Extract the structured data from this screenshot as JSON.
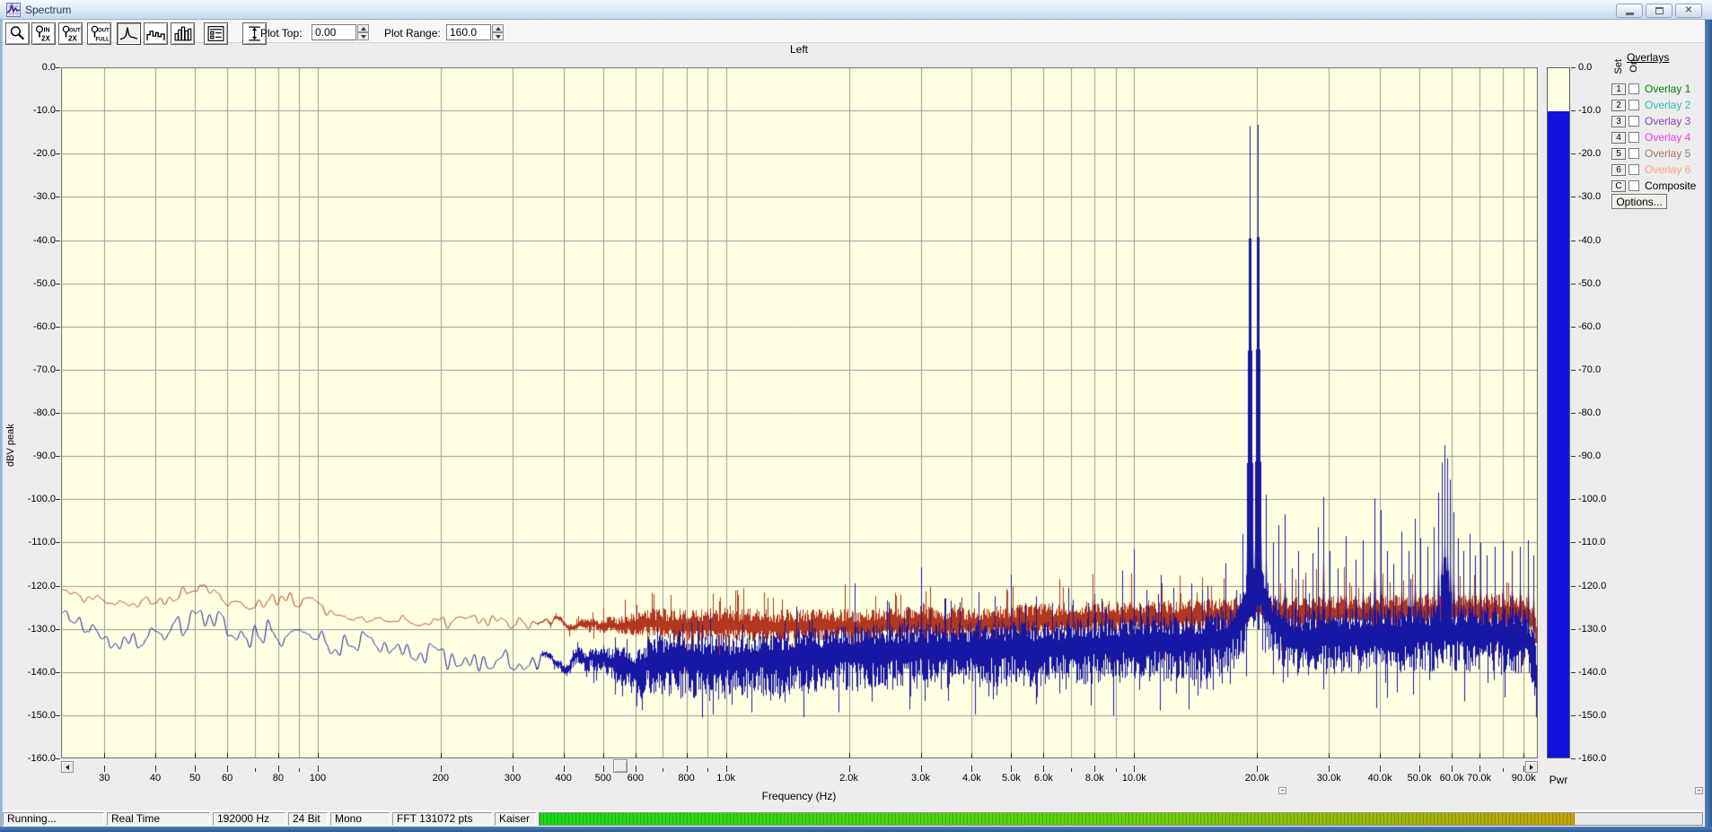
{
  "window": {
    "title": "Spectrum"
  },
  "toolbar": {
    "plot_top_label": "Plot Top:",
    "plot_top_value": "0.00",
    "plot_range_label": "Plot Range:",
    "plot_range_value": "160.0",
    "buttons": [
      "zoom",
      "input-gain-2x",
      "output-gain-2x",
      "output-full",
      "spectrum-curve-mode",
      "stepped-mode",
      "bar-mode",
      "control-panel",
      "vertical-range"
    ]
  },
  "chart_data": {
    "type": "line",
    "title": "Left",
    "xlabel": "Frequency (Hz)",
    "ylabel": "dBV peak",
    "x_scale": "log",
    "x_range_hz": [
      23.5,
      97500
    ],
    "y_range_db": [
      -160,
      0
    ],
    "y_tick_step_db": 10,
    "y_tick_labels": [
      "0.0",
      "-10.0",
      "-20.0",
      "-30.0",
      "-40.0",
      "-50.0",
      "-60.0",
      "-70.0",
      "-80.0",
      "-90.0",
      "-100.0",
      "-110.0",
      "-120.0",
      "-130.0",
      "-140.0",
      "-150.0",
      "-160.0"
    ],
    "x_tick_labels": [
      [
        30,
        "30"
      ],
      [
        40,
        "40"
      ],
      [
        50,
        "50"
      ],
      [
        60,
        "60"
      ],
      [
        80,
        "80"
      ],
      [
        100,
        "100"
      ],
      [
        200,
        "200"
      ],
      [
        300,
        "300"
      ],
      [
        400,
        "400"
      ],
      [
        500,
        "500"
      ],
      [
        600,
        "600"
      ],
      [
        800,
        "800"
      ],
      [
        1000,
        "1.0k"
      ],
      [
        2000,
        "2.0k"
      ],
      [
        3000,
        "3.0k"
      ],
      [
        4000,
        "4.0k"
      ],
      [
        5000,
        "5.0k"
      ],
      [
        6000,
        "6.0k"
      ],
      [
        8000,
        "8.0k"
      ],
      [
        10000,
        "10.0k"
      ],
      [
        20000,
        "20.0k"
      ],
      [
        30000,
        "30.0k"
      ],
      [
        40000,
        "40.0k"
      ],
      [
        50000,
        "50.0k"
      ],
      [
        60000,
        "60.0k"
      ],
      [
        70000,
        "70.0k"
      ],
      [
        90000,
        "90.0k"
      ]
    ],
    "plot_bg": "#FFFFE1",
    "grid_color": "#9A9A9A",
    "border_color": "#6A6A6A",
    "series": [
      {
        "name": "overlay-average-trace",
        "color": "#B2371E",
        "seed": 57,
        "noise_up_db": 4.2,
        "noise_down_db": 3.4,
        "smooth_amp_db": 1.6,
        "baseline": [
          [
            23.5,
            -122.3
          ],
          [
            27,
            -122.6
          ],
          [
            32,
            -123
          ],
          [
            38,
            -123.8
          ],
          [
            44,
            -122.5
          ],
          [
            50,
            -119.8
          ],
          [
            56,
            -122.8
          ],
          [
            65,
            -124.6
          ],
          [
            75,
            -123.4
          ],
          [
            85,
            -122.8
          ],
          [
            95,
            -124
          ],
          [
            110,
            -126.8
          ],
          [
            130,
            -128
          ],
          [
            160,
            -127.6
          ],
          [
            200,
            -128.8
          ],
          [
            260,
            -128.2
          ],
          [
            330,
            -129
          ],
          [
            400,
            -128.6
          ],
          [
            500,
            -129.4
          ],
          [
            650,
            -129
          ],
          [
            800,
            -129.6
          ],
          [
            1000,
            -129.2
          ],
          [
            1300,
            -129.8
          ],
          [
            1700,
            -129.3
          ],
          [
            2200,
            -129.6
          ],
          [
            3000,
            -128.8
          ],
          [
            4000,
            -129.2
          ],
          [
            5000,
            -128.6
          ],
          [
            6500,
            -128.2
          ],
          [
            8000,
            -127.8
          ],
          [
            10000,
            -127.6
          ],
          [
            13000,
            -127.4
          ],
          [
            16000,
            -127.2
          ],
          [
            18500,
            -126.5
          ],
          [
            19600,
            -123.5
          ],
          [
            20600,
            -124.5
          ],
          [
            22000,
            -126.8
          ],
          [
            25000,
            -126.8
          ],
          [
            30000,
            -126.5
          ],
          [
            38000,
            -126.4
          ],
          [
            48000,
            -126.2
          ],
          [
            58000,
            -126
          ],
          [
            70000,
            -126
          ],
          [
            82000,
            -126
          ],
          [
            92000,
            -126.5
          ],
          [
            96000,
            -130
          ],
          [
            97500,
            -134
          ]
        ],
        "peaks": [
          [
            10000,
            -120
          ],
          [
            16700,
            -119
          ],
          [
            19200,
            -71.5
          ],
          [
            20050,
            -69.5
          ],
          [
            21000,
            -112
          ],
          [
            23400,
            -112.5
          ],
          [
            26200,
            -117
          ],
          [
            29100,
            -100.5
          ],
          [
            31500,
            -117
          ],
          [
            33000,
            -114
          ],
          [
            36400,
            -115
          ],
          [
            38800,
            -103.5
          ],
          [
            40100,
            -111
          ],
          [
            43200,
            -116
          ],
          [
            45100,
            -114
          ],
          [
            48600,
            -112.5
          ],
          [
            50100,
            -114
          ],
          [
            52200,
            -115
          ],
          [
            54100,
            -112
          ],
          [
            55600,
            -107
          ],
          [
            56700,
            -101
          ],
          [
            57500,
            -97.5
          ],
          [
            58400,
            -100
          ],
          [
            59400,
            -104
          ],
          [
            60600,
            -110
          ],
          [
            64100,
            -114
          ],
          [
            66200,
            -112
          ],
          [
            70400,
            -114
          ],
          [
            73100,
            -115
          ],
          [
            76300,
            -114
          ],
          [
            80100,
            -112
          ],
          [
            84200,
            -114
          ],
          [
            88300,
            -113
          ],
          [
            92100,
            -112
          ],
          [
            95200,
            -114
          ]
        ]
      },
      {
        "name": "left-channel-spectrum",
        "color": "#1717A3",
        "seed": 13,
        "noise_up_db": 6.5,
        "noise_down_db": 9.0,
        "smooth_amp_db": 2.8,
        "baseline": [
          [
            23.5,
            -128.6
          ],
          [
            26,
            -127.9
          ],
          [
            29,
            -133.3
          ],
          [
            33,
            -132.2
          ],
          [
            37,
            -132.6
          ],
          [
            43,
            -131.4
          ],
          [
            48,
            -128
          ],
          [
            54,
            -126.6
          ],
          [
            60,
            -130
          ],
          [
            66,
            -132
          ],
          [
            75,
            -130.6
          ],
          [
            85,
            -132
          ],
          [
            95,
            -131
          ],
          [
            110,
            -133.5
          ],
          [
            130,
            -133
          ],
          [
            160,
            -134.5
          ],
          [
            200,
            -136.5
          ],
          [
            250,
            -138.5
          ],
          [
            310,
            -136.8
          ],
          [
            380,
            -137.5
          ],
          [
            480,
            -137
          ],
          [
            600,
            -138.5
          ],
          [
            750,
            -136.5
          ],
          [
            950,
            -138
          ],
          [
            1200,
            -137
          ],
          [
            1600,
            -136.2
          ],
          [
            2100,
            -135.6
          ],
          [
            2800,
            -135
          ],
          [
            3600,
            -135
          ],
          [
            4600,
            -134.4
          ],
          [
            6000,
            -134.6
          ],
          [
            7500,
            -134
          ],
          [
            9500,
            -133.6
          ],
          [
            12000,
            -133.2
          ],
          [
            15000,
            -132.8
          ],
          [
            17000,
            -132
          ],
          [
            18500,
            -127
          ],
          [
            19600,
            -121
          ],
          [
            20600,
            -123
          ],
          [
            21800,
            -128
          ],
          [
            24000,
            -132.2
          ],
          [
            30000,
            -131.8
          ],
          [
            37000,
            -131.6
          ],
          [
            45000,
            -131.2
          ],
          [
            55000,
            -130.8
          ],
          [
            65000,
            -131
          ],
          [
            78000,
            -131
          ],
          [
            90000,
            -131.4
          ],
          [
            95000,
            -136
          ],
          [
            97500,
            -145
          ]
        ],
        "peaks": [
          [
            2070,
            -119.5
          ],
          [
            2500,
            -124
          ],
          [
            3000,
            -115.8
          ],
          [
            3450,
            -123
          ],
          [
            4150,
            -121.5
          ],
          [
            5000,
            -117.5
          ],
          [
            5400,
            -124
          ],
          [
            5750,
            -122.5
          ],
          [
            6300,
            -124
          ],
          [
            6900,
            -120.5
          ],
          [
            7700,
            -124
          ],
          [
            8300,
            -123
          ],
          [
            9350,
            -116.5
          ],
          [
            10000,
            -111.5
          ],
          [
            10700,
            -121
          ],
          [
            11600,
            -117.5
          ],
          [
            12500,
            -120.5
          ],
          [
            13800,
            -119.5
          ],
          [
            15100,
            -120
          ],
          [
            16700,
            -114.8
          ],
          [
            17800,
            -121
          ],
          [
            18400,
            -108
          ],
          [
            19200,
            -13.6
          ],
          [
            20050,
            -13.3
          ],
          [
            21000,
            -99
          ],
          [
            21900,
            -110
          ],
          [
            22600,
            -106
          ],
          [
            23400,
            -103.5
          ],
          [
            24300,
            -116
          ],
          [
            25200,
            -112
          ],
          [
            26200,
            -118
          ],
          [
            27300,
            -112.5
          ],
          [
            28200,
            -106.5
          ],
          [
            29100,
            -99.5
          ],
          [
            30100,
            -112
          ],
          [
            31500,
            -116
          ],
          [
            33000,
            -108.5
          ],
          [
            34800,
            -114
          ],
          [
            36400,
            -109.5
          ],
          [
            38800,
            -99.8
          ],
          [
            40100,
            -102.5
          ],
          [
            41600,
            -112
          ],
          [
            43200,
            -115
          ],
          [
            45100,
            -107.5
          ],
          [
            47000,
            -112
          ],
          [
            48600,
            -104.5
          ],
          [
            50100,
            -109
          ],
          [
            52200,
            -111
          ],
          [
            54100,
            -106.5
          ],
          [
            55600,
            -98.5
          ],
          [
            56700,
            -91.5
          ],
          [
            57500,
            -87.5
          ],
          [
            58400,
            -90.5
          ],
          [
            59400,
            -95.5
          ],
          [
            60600,
            -103
          ],
          [
            62100,
            -109
          ],
          [
            64100,
            -112
          ],
          [
            66200,
            -108
          ],
          [
            68300,
            -113
          ],
          [
            70400,
            -110
          ],
          [
            73100,
            -113
          ],
          [
            76300,
            -111
          ],
          [
            80100,
            -109.5
          ],
          [
            84200,
            -112
          ],
          [
            88300,
            -111
          ],
          [
            92100,
            -109.5
          ],
          [
            95200,
            -113
          ]
        ]
      }
    ],
    "power_meter": {
      "label": "Pwr",
      "value_db": -10,
      "fill_color": "#1212DF",
      "bg": "#FFFFE1"
    }
  },
  "overlays_panel": {
    "title": "Overlays",
    "col_set": "Set",
    "col_on": "On",
    "rows": [
      {
        "set": "1",
        "label": "Overlay 1",
        "color": "#008000",
        "checked": false
      },
      {
        "set": "2",
        "label": "Overlay 2",
        "color": "#2FB9B9",
        "checked": false
      },
      {
        "set": "3",
        "label": "Overlay 3",
        "color": "#8A42BF",
        "checked": false
      },
      {
        "set": "4",
        "label": "Overlay 4",
        "color": "#F23FF2",
        "checked": false
      },
      {
        "set": "5",
        "label": "Overlay 5",
        "color": "#A5785A",
        "checked": false
      },
      {
        "set": "6",
        "label": "Overlay 6",
        "color": "#FF9F80",
        "checked": false
      },
      {
        "set": "C",
        "label": "Composite",
        "color": "#000000",
        "checked": false
      }
    ],
    "options_label": "Options..."
  },
  "status_bar": {
    "items": [
      "Running...",
      "Real Time",
      "192000 Hz",
      "24 Bit",
      "Mono",
      "FFT 131072 pts",
      "Kaiser"
    ],
    "progress_percent": 89
  }
}
